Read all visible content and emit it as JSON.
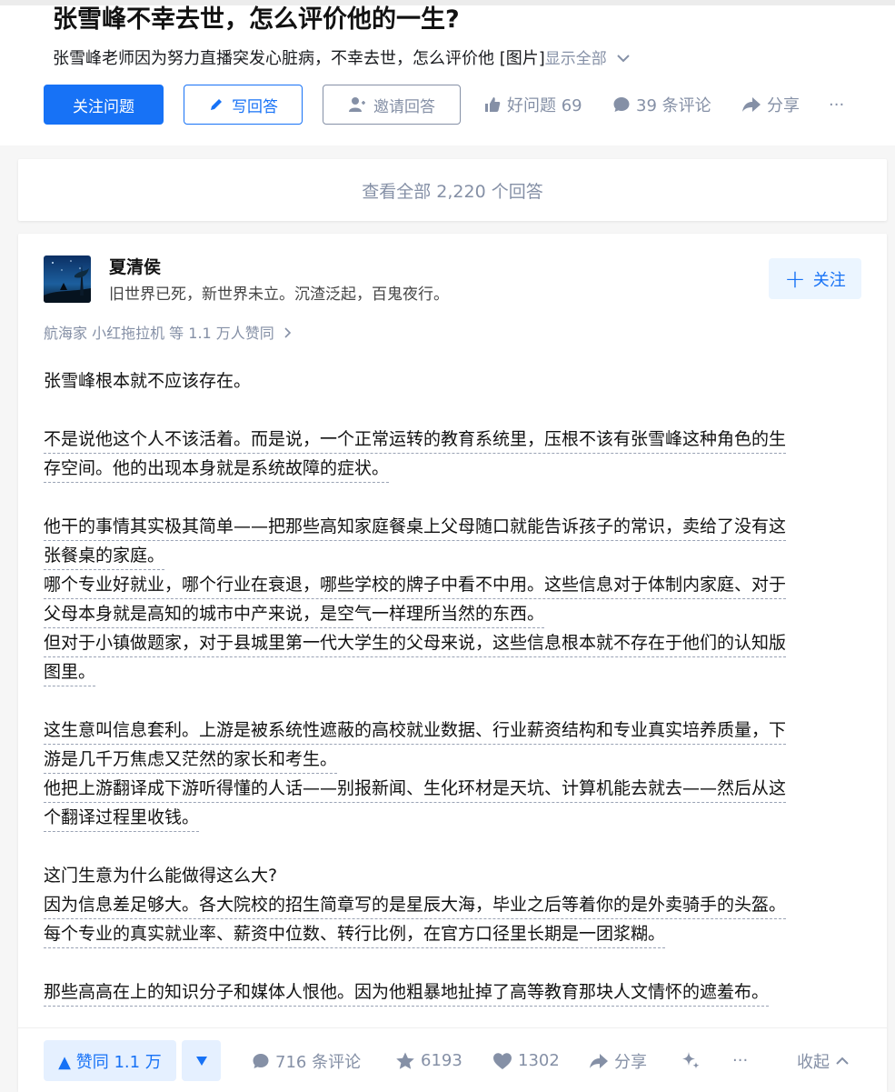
{
  "question": {
    "title": "张雪峰不幸去世，怎么评价他的一生?",
    "excerpt": "张雪峰老师因为努力直播突发心脏病，不幸去世，怎么评价他 [图片]",
    "show_all": "显示全部",
    "follow_label": "关注问题",
    "write_label": "写回答",
    "invite_label": "邀请回答",
    "good_question_label": "好问题 69",
    "comments_label": "39 条评论",
    "share_label": "分享",
    "more_label": "···"
  },
  "view_all_label": "查看全部 2,220 个回答",
  "answer": {
    "author": {
      "name": "夏清侯",
      "bio": "旧世界已死，新世界未立。沉渣泛起，百鬼夜行。",
      "follow_label": "关注"
    },
    "voters": "航海家 小红拖拉机 等 1.1 万人赞同",
    "paragraphs": [
      {
        "lines": [
          "张雪峰根本就不应该存在。"
        ],
        "dashed": false
      },
      {
        "lines": [
          "不是说他这个人不该活着。而是说，一个正常运转的教育系统里，压根不该有张雪峰这种角色的生",
          "存空间。他的出现本身就是系统故障的症状。"
        ],
        "dashed": true
      },
      {
        "lines": [
          "他干的事情其实极其简单——把那些高知家庭餐桌上父母随口就能告诉孩子的常识，卖给了没有这",
          "张餐桌的家庭。",
          "哪个专业好就业，哪个行业在衰退，哪些学校的牌子中看不中用。这些信息对于体制内家庭、对于",
          "父母本身就是高知的城市中产来说，是空气一样理所当然的东西。",
          "但对于小镇做题家，对于县城里第一代大学生的父母来说，这些信息根本就不存在于他们的认知版",
          "图里。"
        ],
        "dashed": true
      },
      {
        "lines": [
          "这生意叫信息套利。上游是被系统性遮蔽的高校就业数据、行业薪资结构和专业真实培养质量，下",
          "游是几千万焦虑又茫然的家长和考生。",
          "他把上游翻译成下游听得懂的人话——别报新闻、生化环材是天坑、计算机能去就去——然后从这",
          "个翻译过程里收钱。"
        ],
        "dashed": true
      },
      {
        "lines": [
          "这门生意为什么能做得这么大?"
        ],
        "dashed": false
      },
      {
        "lines": [
          "因为信息差足够大。各大院校的招生简章写的是星辰大海，毕业之后等着你的是外卖骑手的头盔。",
          "每个专业的真实就业率、薪资中位数、转行比例，在官方口径里长期是一团浆糊。"
        ],
        "dashed": true
      },
      {
        "lines": [
          "那些高高在上的知识分子和媒体人恨他。因为他粗暴地扯掉了高等教育那块人文情怀的遮羞布。"
        ],
        "dashed": true
      }
    ],
    "actions": {
      "upvote_label": "▲ 赞同 1.1 万",
      "comments_label": "716 条评论",
      "favorites_label": "6193",
      "likes_label": "1302",
      "share_label": "分享",
      "more_label": "···",
      "collapse_label": "收起"
    }
  },
  "colors": {
    "brand_blue": "#1772f6",
    "muted": "#8590a6",
    "text": "#121212",
    "vote_bg": "#e5f0ff"
  }
}
